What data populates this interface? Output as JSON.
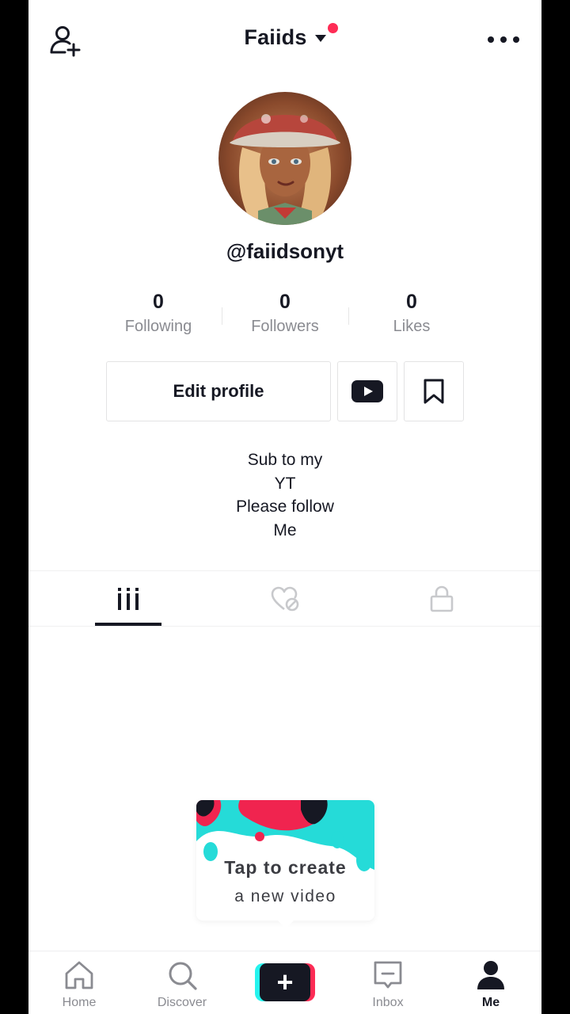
{
  "header": {
    "title": "Faiids",
    "icons": {
      "add_user": "add-user-icon",
      "more": "more-options-icon",
      "caret": "caret-down-icon"
    },
    "notification_dot_color": "#fe2c55"
  },
  "profile": {
    "username": "@faiidsonyt",
    "stats": [
      {
        "value": "0",
        "label": "Following"
      },
      {
        "value": "0",
        "label": "Followers"
      },
      {
        "value": "0",
        "label": "Likes"
      }
    ],
    "edit_profile_label": "Edit profile",
    "bio": [
      "Sub to my",
      "YT",
      "Please follow",
      "Me"
    ]
  },
  "tabs": [
    {
      "icon": "videos-grid-icon",
      "active": true
    },
    {
      "icon": "liked-heart-icon",
      "active": false
    },
    {
      "icon": "lock-icon",
      "active": false
    }
  ],
  "create_prompt": {
    "line1": "Tap to create",
    "line2": "a new video"
  },
  "bottom_nav": {
    "home": "Home",
    "discover": "Discover",
    "create": "+",
    "inbox": "Inbox",
    "me": "Me"
  },
  "colors": {
    "accent_pink": "#fe2c55",
    "accent_cyan": "#25f4ee",
    "text": "#161823",
    "muted": "#8a8b91"
  }
}
